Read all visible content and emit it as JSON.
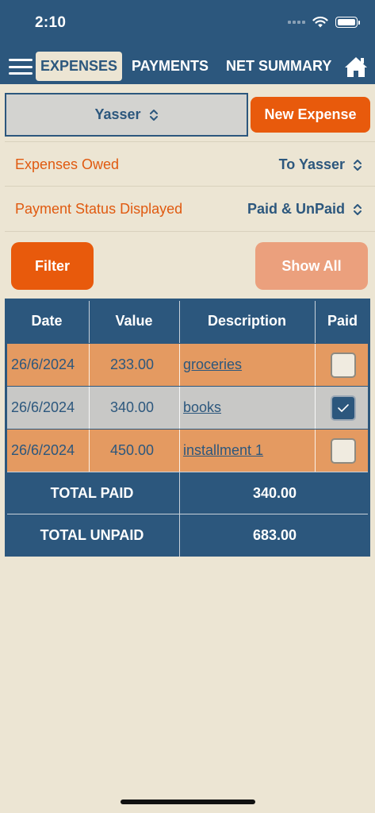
{
  "status_bar": {
    "time": "2:10"
  },
  "nav": {
    "tabs": [
      {
        "label": "EXPENSES",
        "active": true
      },
      {
        "label": "PAYMENTS",
        "active": false
      },
      {
        "label": "NET SUMMARY",
        "active": false
      }
    ]
  },
  "person_select": {
    "value": "Yasser"
  },
  "new_expense": {
    "label": "New Expense"
  },
  "settings": {
    "owed": {
      "label": "Expenses Owed",
      "value": "To Yasser"
    },
    "status": {
      "label": "Payment Status Displayed",
      "value": "Paid & UnPaid"
    }
  },
  "buttons": {
    "filter": "Filter",
    "show_all": "Show All"
  },
  "table": {
    "headers": [
      "Date",
      "Value",
      "Description",
      "Paid"
    ],
    "rows": [
      {
        "date": "26/6/2024",
        "value": "233.00",
        "description": "groceries",
        "paid": false
      },
      {
        "date": "26/6/2024",
        "value": "340.00",
        "description": "books",
        "paid": true
      },
      {
        "date": "26/6/2024",
        "value": "450.00",
        "description": "installment 1",
        "paid": false
      }
    ],
    "total_paid_label": "TOTAL PAID",
    "total_paid_value": "340.00",
    "total_unpaid_label": "TOTAL UNPAID",
    "total_unpaid_value": "683.00"
  },
  "colors": {
    "primary": "#2c577d",
    "accent": "#e85a0c",
    "background": "#ece5d3",
    "unpaid_row": "#e49a61",
    "paid_row": "#c8c8c6"
  }
}
